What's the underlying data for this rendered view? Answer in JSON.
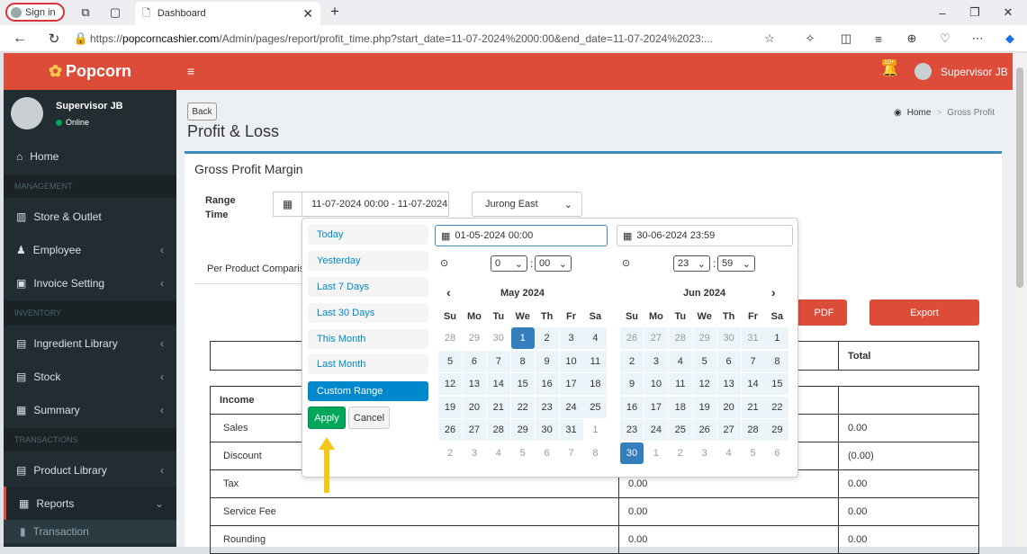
{
  "browser": {
    "signin": "Sign in",
    "tab_title": "Dashboard",
    "url_scheme": "https://",
    "url_host": "popcorncashier.com",
    "url_path": "/Admin/pages/report/profit_time.php?start_date=11-07-2024%2000:00&end_date=11-07-2024%2023:..."
  },
  "app": {
    "brand": "Popcorn",
    "notif_badge": "10+",
    "user": "Supervisor JB",
    "status": "Online"
  },
  "sidebar": {
    "home": "Home",
    "sec_management": "MANAGEMENT",
    "store": "Store & Outlet",
    "employee": "Employee",
    "invoice": "Invoice Setting",
    "sec_inventory": "INVENTORY",
    "ingredient": "Ingredient Library",
    "stock": "Stock",
    "summary": "Summary",
    "sec_transactions": "TRANSACTIONS",
    "product": "Product Library",
    "reports": "Reports",
    "transaction": "Transaction"
  },
  "page": {
    "back": "Back",
    "title": "Profit & Loss",
    "bc_home": "Home",
    "bc_sep": ">",
    "bc_current": "Gross Profit",
    "box_title": "Gross Profit Margin",
    "range_label": "Range Time",
    "range_value": "11-07-2024 00:00 - 11-07-2024",
    "outlet": "Jurong East",
    "per_product": "Per Product Comparis",
    "pdf": "PDF",
    "export": "Export"
  },
  "table": {
    "total": "Total",
    "income": "Income",
    "rows": [
      {
        "label": "Sales",
        "mid": "",
        "total": "0.00"
      },
      {
        "label": "Discount",
        "mid": "",
        "total": "(0.00)"
      },
      {
        "label": "Tax",
        "mid": "0.00",
        "total": "0.00"
      },
      {
        "label": "Service Fee",
        "mid": "0.00",
        "total": "0.00"
      },
      {
        "label": "Rounding",
        "mid": "0.00",
        "total": "0.00"
      }
    ]
  },
  "picker": {
    "ranges": [
      "Today",
      "Yesterday",
      "Last 7 Days",
      "Last 30 Days",
      "This Month",
      "Last Month",
      "Custom Range"
    ],
    "apply": "Apply",
    "cancel": "Cancel",
    "start_input": "01-05-2024 00:00",
    "end_input": "30-06-2024 23:59",
    "start_hour": "0",
    "start_min": "00",
    "end_hour": "23",
    "end_min": "59",
    "left_month": "May 2024",
    "right_month": "Jun 2024",
    "weekdays": [
      "Su",
      "Mo",
      "Tu",
      "We",
      "Th",
      "Fr",
      "Sa"
    ],
    "left_days": [
      "28",
      "29",
      "30",
      "1",
      "2",
      "3",
      "4",
      "5",
      "6",
      "7",
      "8",
      "9",
      "10",
      "11",
      "12",
      "13",
      "14",
      "15",
      "16",
      "17",
      "18",
      "19",
      "20",
      "21",
      "22",
      "23",
      "24",
      "25",
      "26",
      "27",
      "28",
      "29",
      "30",
      "31",
      "1",
      "2",
      "3",
      "4",
      "5",
      "6",
      "7",
      "8"
    ],
    "right_days": [
      "26",
      "27",
      "28",
      "29",
      "30",
      "31",
      "1",
      "2",
      "3",
      "4",
      "5",
      "6",
      "7",
      "8",
      "9",
      "10",
      "11",
      "12",
      "13",
      "14",
      "15",
      "16",
      "17",
      "18",
      "19",
      "20",
      "21",
      "22",
      "23",
      "24",
      "25",
      "26",
      "27",
      "28",
      "29",
      "30",
      "1",
      "2",
      "3",
      "4",
      "5",
      "6"
    ]
  }
}
